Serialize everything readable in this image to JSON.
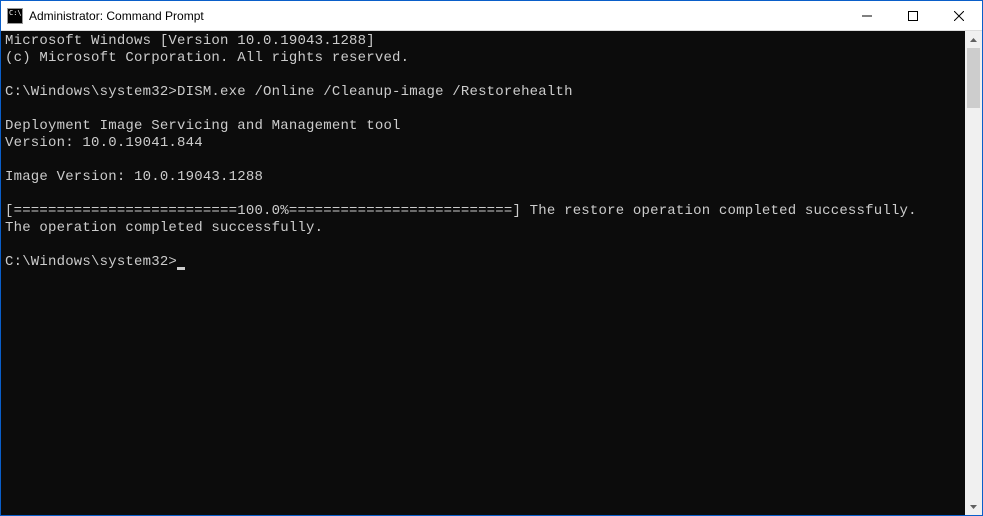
{
  "titlebar": {
    "title": "Administrator: Command Prompt"
  },
  "terminal": {
    "line1": "Microsoft Windows [Version 10.0.19043.1288]",
    "line2": "(c) Microsoft Corporation. All rights reserved.",
    "blank1": "",
    "prompt1": "C:\\Windows\\system32>DISM.exe /Online /Cleanup-image /Restorehealth",
    "blank2": "",
    "tool1": "Deployment Image Servicing and Management tool",
    "tool2": "Version: 10.0.19041.844",
    "blank3": "",
    "image_version": "Image Version: 10.0.19043.1288",
    "blank4": "",
    "progress": "[==========================100.0%==========================] The restore operation completed successfully.",
    "completed": "The operation completed successfully.",
    "blank5": "",
    "prompt2": "C:\\Windows\\system32>"
  }
}
